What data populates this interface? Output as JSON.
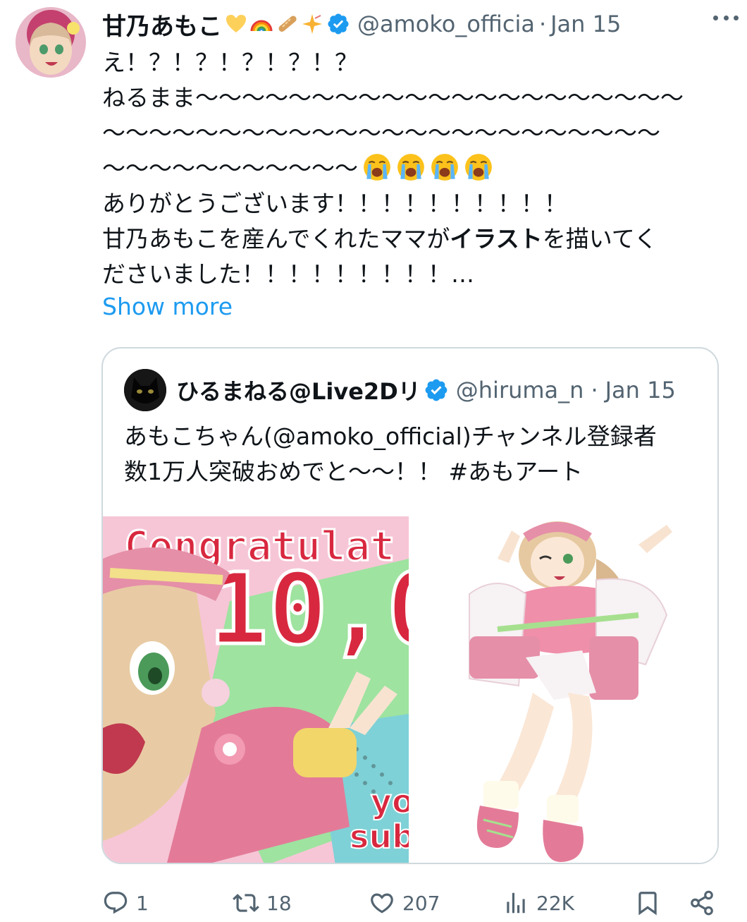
{
  "tweet": {
    "display_name": "甘乃あもこ",
    "emojis": [
      "yellow-heart",
      "rainbow",
      "baguette",
      "sparkle"
    ],
    "handle": "@amoko_officia",
    "separator": "·",
    "date": "Jan 15",
    "lines": [
      "え！？！？！？！？！？",
      "ねるまま〜〜〜〜〜〜〜〜〜〜〜〜〜〜〜〜〜〜〜〜〜",
      "〜〜〜〜〜〜〜〜〜〜〜〜〜〜〜〜〜〜〜〜〜〜〜〜",
      "〜〜〜〜〜〜〜〜〜〜〜",
      "ありがとうございます！！！！！！！！！！"
    ],
    "line6_before": "甘乃あもこを産んでくれたママが",
    "line6_bold": "イラスト",
    "line6_after": "を描いてく",
    "line7": "ださいました！！！！！！！！！…",
    "show_more": "Show more"
  },
  "quote": {
    "display_name": "ひるまねる@Live2Dリ",
    "handle": "@hiruma_n",
    "separator": "·",
    "date": "Jan 15",
    "text_line1": "あもこちゃん(@amoko_official)チャンネル登録者",
    "text_line2": "数1万人突破おめでと〜〜！！ #あもアート",
    "image1_text_top": "Congratulat",
    "image1_text_big": "10,0",
    "image1_text_corner": "yo\nsub"
  },
  "actions": {
    "replies": "1",
    "reposts": "18",
    "likes": "207",
    "views": "22K"
  },
  "colors": {
    "text": "#0f1419",
    "secondary": "#536471",
    "link": "#1d9bf0",
    "verified": "#1d9bf0",
    "border": "#cfd9de"
  }
}
